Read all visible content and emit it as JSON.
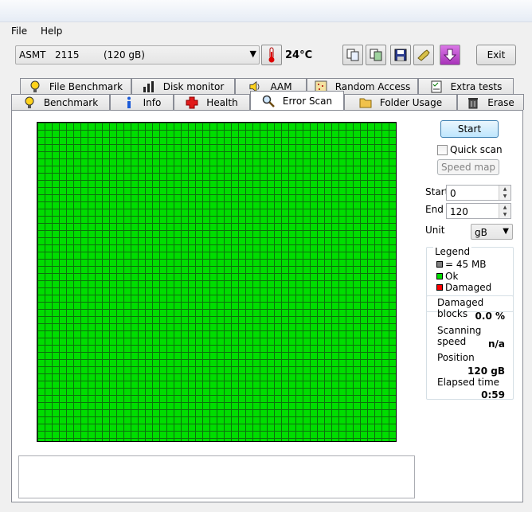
{
  "menu": {
    "file": "File",
    "help": "Help"
  },
  "drive": {
    "model": "ASMT   2115",
    "capacity": "(120 gB)"
  },
  "temperature": "24°C",
  "toolbar": {
    "exit": "Exit"
  },
  "tabs_top": [
    "File Benchmark",
    "Disk monitor",
    "AAM",
    "Random Access",
    "Extra tests"
  ],
  "tabs_bottom": [
    "Benchmark",
    "Info",
    "Health",
    "Error Scan",
    "Folder Usage",
    "Erase"
  ],
  "active_tab": "Error Scan",
  "controls": {
    "start": "Start",
    "quick_scan": "Quick scan",
    "quick_scan_checked": false,
    "speed_map": "Speed map",
    "start_label": "Start",
    "start_value": "0",
    "end_label": "End",
    "end_value": "120",
    "unit_label": "Unit",
    "unit_value": "gB"
  },
  "legend": {
    "title": "Legend",
    "items": [
      {
        "label": "= 45 MB",
        "color": "#808080"
      },
      {
        "label": "Ok",
        "color": "#00dd00"
      },
      {
        "label": "Damaged",
        "color": "#ff0000"
      }
    ]
  },
  "stats": {
    "damaged_blocks_label": "Damaged blocks",
    "damaged_blocks_value": "0.0 %",
    "scanning_speed_label": "Scanning speed",
    "scanning_speed_value": "n/a",
    "position_label": "Position",
    "position_value": "120 gB",
    "elapsed_time_label": "Elapsed time",
    "elapsed_time_value": "0:59"
  },
  "colors": {
    "ok": "#00dd00",
    "grid_line": "#0d6f0d",
    "accent": "#3c7fb1"
  }
}
